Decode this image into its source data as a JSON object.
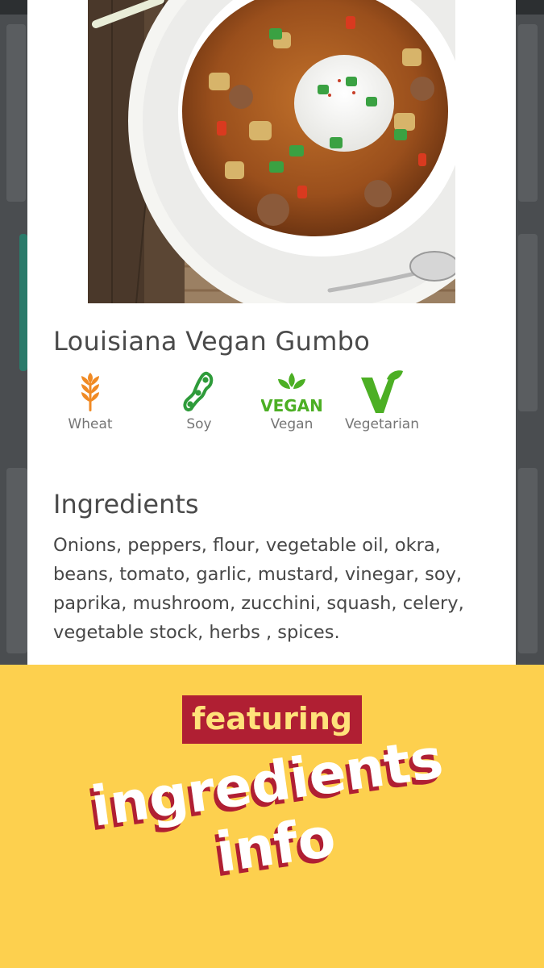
{
  "recipe": {
    "title": "Louisiana Vegan Gumbo",
    "diets": [
      {
        "label": "Wheat",
        "icon": "wheat-icon",
        "color": "#f08a24"
      },
      {
        "label": "Soy",
        "icon": "soybean-icon",
        "color": "#2e9b3a"
      },
      {
        "label": "Vegan",
        "icon": "vegan-icon",
        "badge_text": "VEGAN",
        "color": "#4caf24"
      },
      {
        "label": "Vegetarian",
        "icon": "vegetarian-v-icon",
        "color": "#4caf24"
      }
    ],
    "ingredients_title": "Ingredients",
    "ingredients_text": "Onions, peppers, flour, vegetable oil, okra, beans, tomato, garlic, mustard, vinegar, soy, paprika, mushroom, zucchini, squash, celery, vegetable stock, herbs , spices."
  },
  "promo": {
    "featuring": "featuring",
    "line1": "ingredients",
    "line2": "info",
    "bg_color": "#fdd04e",
    "accent_color": "#b01f33"
  }
}
